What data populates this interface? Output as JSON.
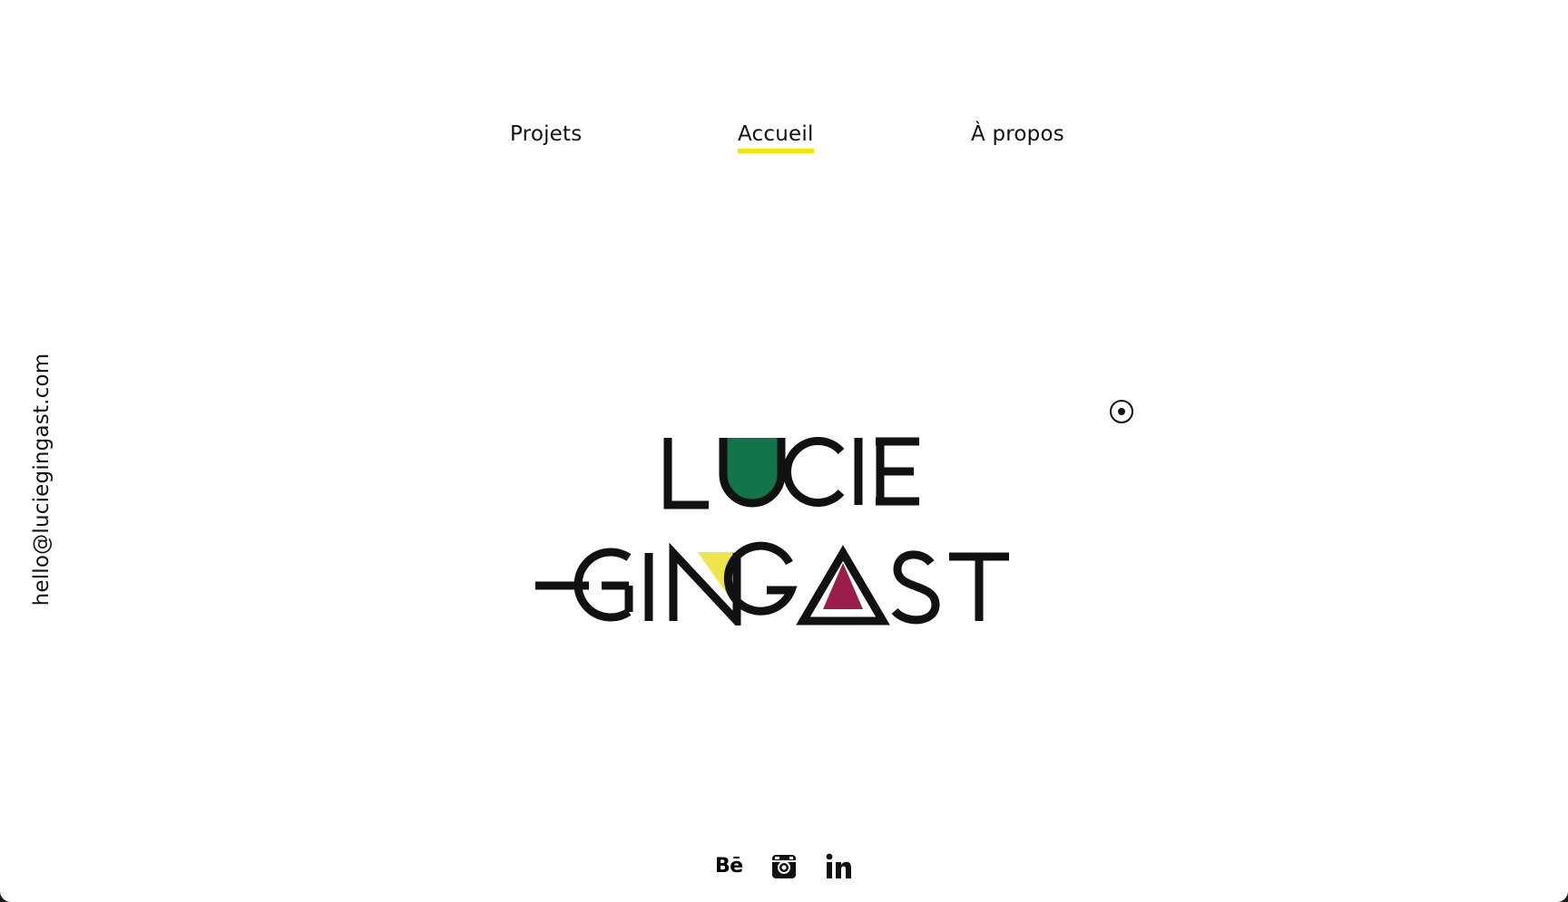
{
  "nav": {
    "items": [
      {
        "label": "Projets",
        "active": false
      },
      {
        "label": "Accueil",
        "active": true
      },
      {
        "label": "À propos",
        "active": false
      }
    ],
    "active_underline_color": "#f5e400"
  },
  "contact": {
    "email": "hello@luciegingast.com"
  },
  "logo": {
    "line1": "LUCIE",
    "line2": "GINGAST",
    "accent_colors": {
      "u_fill": "#11744a",
      "n_fill": "#f0e44c",
      "a_fill": "#9b1d4a"
    }
  },
  "social": {
    "behance_label": "Bē",
    "icons": [
      "behance-icon",
      "instagram-icon",
      "linkedin-icon"
    ]
  }
}
